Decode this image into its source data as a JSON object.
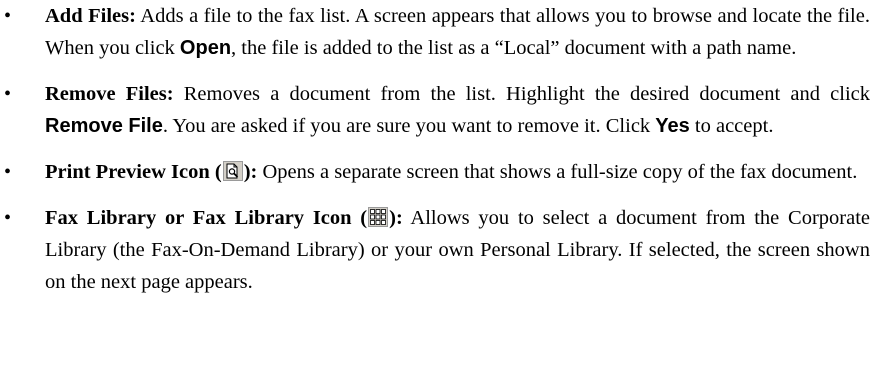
{
  "items": [
    {
      "term": "Add Files:",
      "text1": " Adds a file to the fax list. A screen appears that allows you to browse and locate the file. When you click ",
      "action": "Open",
      "text2": ", the file is added to the list as a “Local” document with a path name."
    },
    {
      "term": "Remove Files:",
      "text1": " Removes a document from the list. Highlight the desired document and click ",
      "action": "Remove File",
      "text2": ". You are asked if you are sure you want to remove it. Click ",
      "action2": "Yes",
      "text3": " to accept."
    },
    {
      "term_start": "Print Preview Icon (",
      "icon": "print-preview-icon",
      "term_end": "):",
      "text1": " Opens a separate screen that shows a full-size copy of the fax document."
    },
    {
      "term_start": "Fax Library or Fax Library Icon (",
      "icon": "fax-library-icon",
      "term_end": "):",
      "text1": " Allows you to select a document from the Corporate Library (the Fax-On-Demand Library) or your own Personal Library. If selected, the screen shown on the next page appears."
    }
  ]
}
